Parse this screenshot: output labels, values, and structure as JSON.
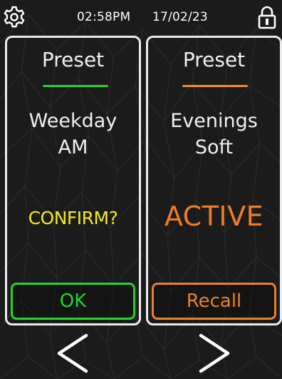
{
  "header": {
    "time": "02:58PM",
    "date": "17/02/23",
    "settings_icon": "gear-icon",
    "lock_icon": "lock-icon"
  },
  "panels": [
    {
      "title": "Preset",
      "name_line1": "Weekday",
      "name_line2": "AM",
      "status": "CONFIRM?",
      "button_label": "OK",
      "accent_color": "#22d42c",
      "status_color": "#f2ea1c"
    },
    {
      "title": "Preset",
      "name_line1": "Evenings",
      "name_line2": "Soft",
      "status": "ACTIVE",
      "button_label": "Recall",
      "accent_color": "#f08a2c",
      "status_color": "#f07c26"
    }
  ],
  "navigation": {
    "prev_icon": "chevron-left-icon",
    "next_icon": "chevron-right-icon"
  },
  "colors": {
    "background": "#1c1c1c",
    "panel_border": "#ececec"
  }
}
